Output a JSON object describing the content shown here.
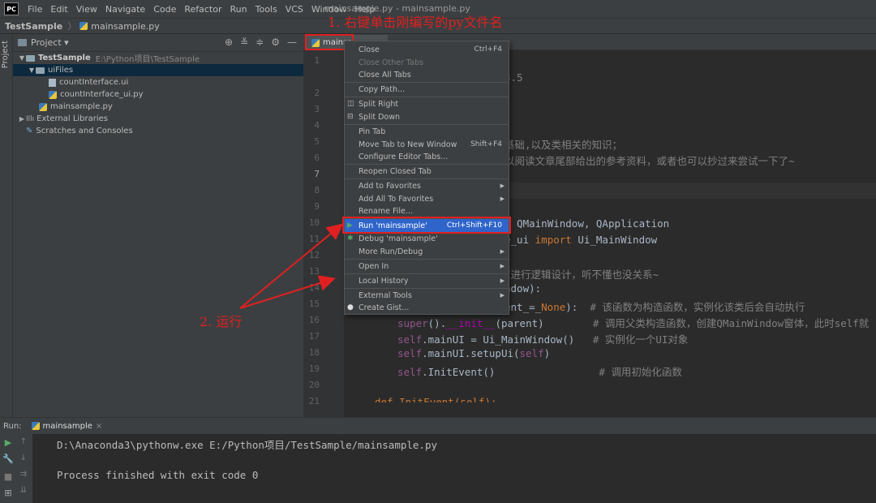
{
  "app": {
    "logo": "PC",
    "window_title": "mainsample.py - mainsample.py"
  },
  "menubar": [
    "File",
    "Edit",
    "View",
    "Navigate",
    "Code",
    "Refactor",
    "Run",
    "Tools",
    "VCS",
    "Window",
    "Help"
  ],
  "breadcrumb": [
    "TestSample",
    "mainsample.py"
  ],
  "toolstrip": {
    "label": "Project"
  },
  "project_panel": {
    "title": "Project ▾",
    "tree": [
      {
        "label": "TestSample",
        "hint": "E:\\Python项目\\TestSample"
      },
      {
        "label": "uiFiles"
      },
      {
        "label": "countInterface.ui"
      },
      {
        "label": "countInterface_ui.py"
      },
      {
        "label": "mainsample.py"
      },
      {
        "label": "External Libraries"
      },
      {
        "label": "Scratches and Consoles"
      }
    ]
  },
  "editor": {
    "tab_label": "mainsa",
    "line_numbers": [
      "1",
      "2",
      "3",
      "4",
      "5",
      "6",
      "7",
      "8",
      "9",
      "10",
      "11",
      "12",
      "13",
      "14",
      "15",
      "16",
      "17",
      "18",
      "19",
      "20",
      "21"
    ],
    "code": {
      "l2": "3.5",
      "l6": "基础,以及类相关的知识；",
      "l7": "以阅读文章尾部给出的参考资料，或者也可以抄过来尝试一下了~",
      "l11a": "t ",
      "l11b": "QMainWindow, QApplication",
      "l12a": "e_ui ",
      "l12b": "import",
      "l12c": " Ui_MainWindow",
      "l14": "C进行逻辑设计，听不懂也没关系~",
      "l15": "ndow):",
      "l16a": "ent_=_",
      "l16b": "None",
      "l16c": "):  ",
      "l16d": "# 该函数为构造函数，实例化该类后会自动执行",
      "l17a": "super",
      "l17b": "().",
      "l17c": "__init__",
      "l17d": "(parent)        ",
      "l17e": "# 调用父类构造函数，创建QMainWindow窗体，此时self就",
      "l18a": "self",
      "l18b": ".mainUI = Ui_MainWindow()   ",
      "l18c": "# 实例化一个UI对象",
      "l19a": "self",
      "l19b": ".mainUI.setupUi(",
      "l19c": "self",
      "l19d": ")",
      "l20a": "self",
      "l20b": ".InitEvent()                 ",
      "l20c": "# 调用初始化函数",
      "l22": "def InitEvent(self):"
    }
  },
  "context_menu": {
    "items": [
      {
        "label": "Close",
        "shortcut": "Ctrl+F4"
      },
      {
        "label": "Close Other Tabs"
      },
      {
        "label": "Close All Tabs"
      },
      {
        "label": "Copy Path..."
      },
      {
        "label": "Split Right"
      },
      {
        "label": "Split Down"
      },
      {
        "label": "Pin Tab"
      },
      {
        "label": "Move Tab to New Window",
        "shortcut": "Shift+F4"
      },
      {
        "label": "Configure Editor Tabs..."
      },
      {
        "label": "Reopen Closed Tab"
      },
      {
        "label": "Add to Favorites"
      },
      {
        "label": "Add All To Favorites"
      },
      {
        "label": "Rename File..."
      },
      {
        "label": "Run 'mainsample'",
        "shortcut": "Ctrl+Shift+F10"
      },
      {
        "label": "Debug 'mainsample'"
      },
      {
        "label": "More Run/Debug"
      },
      {
        "label": "Open In"
      },
      {
        "label": "Local History"
      },
      {
        "label": "External Tools"
      },
      {
        "label": "Create Gist..."
      }
    ]
  },
  "annotations": {
    "step1": "1. 右键单击刚编写的py文件名",
    "step2": "2. 运行"
  },
  "run_panel": {
    "label": "Run:",
    "tab": "mainsample",
    "console": [
      "D:\\Anaconda3\\pythonw.exe E:/Python项目/TestSample/mainsample.py",
      "",
      "Process finished with exit code 0"
    ]
  }
}
